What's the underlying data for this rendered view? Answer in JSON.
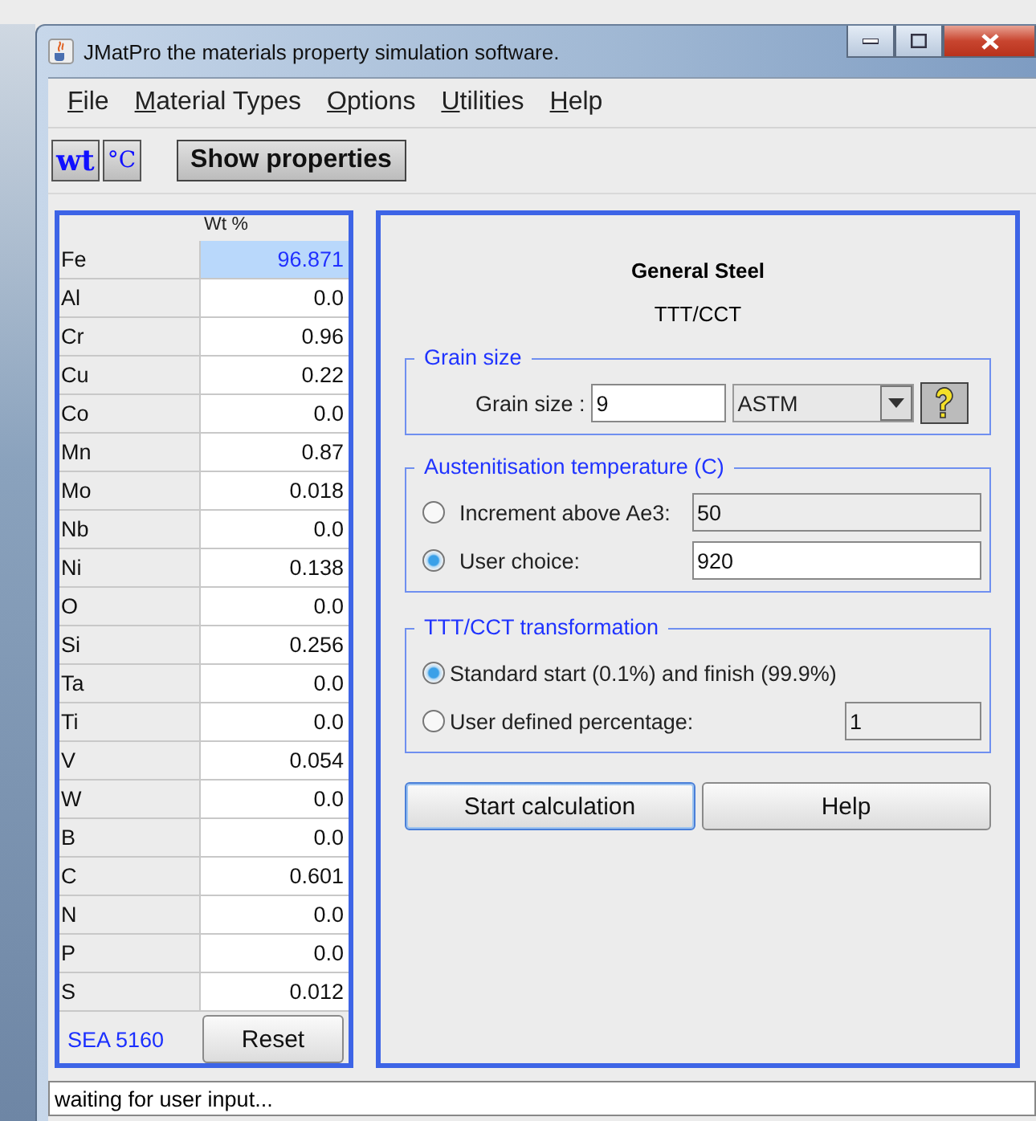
{
  "window": {
    "title": "JMatPro the materials property simulation software."
  },
  "menu": [
    {
      "label": "File"
    },
    {
      "label": "Material Types"
    },
    {
      "label": "Options"
    },
    {
      "label": "Utilities"
    },
    {
      "label": "Help"
    }
  ],
  "toolbar": {
    "units": [
      {
        "label": "wt",
        "kind": "large"
      },
      {
        "label": "°C",
        "kind": "small"
      }
    ],
    "show_properties": "Show properties"
  },
  "composition": {
    "column": "Wt %",
    "rows": [
      {
        "element": "Fe",
        "value": "96.871",
        "selected": true
      },
      {
        "element": "Al",
        "value": "0.0",
        "selected": false
      },
      {
        "element": "Cr",
        "value": "0.96",
        "selected": false
      },
      {
        "element": "Cu",
        "value": "0.22",
        "selected": false
      },
      {
        "element": "Co",
        "value": "0.0",
        "selected": false
      },
      {
        "element": "Mn",
        "value": "0.87",
        "selected": false
      },
      {
        "element": "Mo",
        "value": "0.018",
        "selected": false
      },
      {
        "element": "Nb",
        "value": "0.0",
        "selected": false
      },
      {
        "element": "Ni",
        "value": "0.138",
        "selected": false
      },
      {
        "element": "O",
        "value": "0.0",
        "selected": false
      },
      {
        "element": "Si",
        "value": "0.256",
        "selected": false
      },
      {
        "element": "Ta",
        "value": "0.0",
        "selected": false
      },
      {
        "element": "Ti",
        "value": "0.0",
        "selected": false
      },
      {
        "element": "V",
        "value": "0.054",
        "selected": false
      },
      {
        "element": "W",
        "value": "0.0",
        "selected": false
      },
      {
        "element": "B",
        "value": "0.0",
        "selected": false
      },
      {
        "element": "C",
        "value": "0.601",
        "selected": false
      },
      {
        "element": "N",
        "value": "0.0",
        "selected": false
      },
      {
        "element": "P",
        "value": "0.0",
        "selected": false
      },
      {
        "element": "S",
        "value": "0.012",
        "selected": false
      }
    ],
    "grade": "SEA 5160",
    "reset": "Reset"
  },
  "calculation": {
    "title": "General Steel",
    "subtitle": "TTT/CCT",
    "grain": {
      "legend": "Grain size",
      "label": "Grain size :",
      "value": "9",
      "unit": "ASTM"
    },
    "austenitisation": {
      "legend": "Austenitisation temperature (C)",
      "options": [
        {
          "label": "Increment above Ae3:",
          "value": "50",
          "selected": false,
          "disabled": true
        },
        {
          "label": "User choice:",
          "value": "920",
          "selected": true,
          "disabled": false
        }
      ]
    },
    "transformation": {
      "legend": "TTT/CCT transformation",
      "options": [
        {
          "label": "Standard start (0.1%) and finish (99.9%)",
          "selected": true
        },
        {
          "label": "User defined percentage:",
          "value": "1",
          "selected": false,
          "disabled": true
        }
      ]
    },
    "buttons": [
      {
        "label": "Start calculation",
        "focused": true
      },
      {
        "label": "Help",
        "focused": false
      }
    ]
  },
  "status_bar": "waiting for user input..."
}
